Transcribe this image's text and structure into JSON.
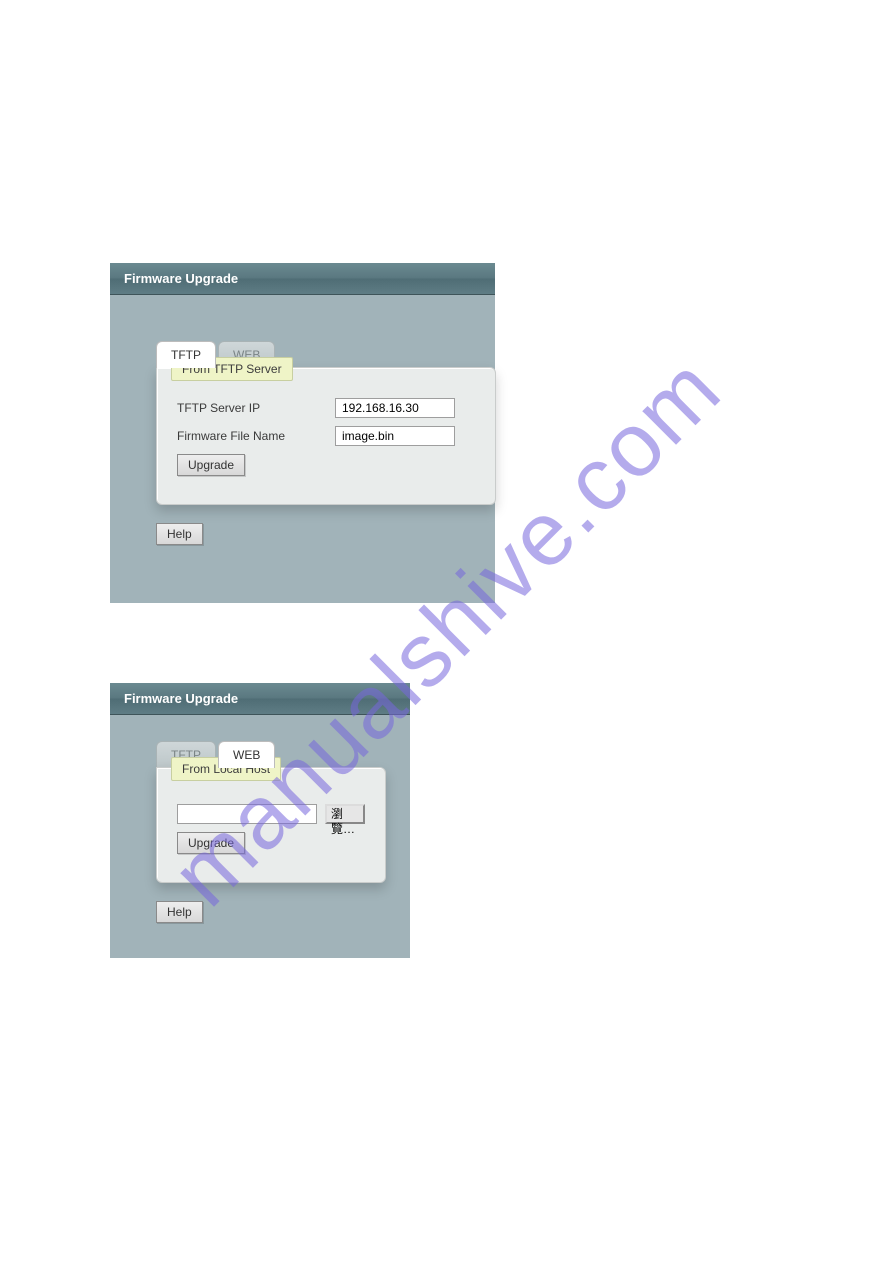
{
  "watermark_text": "manualshive.com",
  "panel1": {
    "title": "Firmware Upgrade",
    "tabs": {
      "tftp": "TFTP",
      "web": "WEB"
    },
    "legend": "From TFTP Server",
    "fields": {
      "server_ip_label": "TFTP Server IP",
      "server_ip_value": "192.168.16.30",
      "fw_file_label": "Firmware File Name",
      "fw_file_value": "image.bin"
    },
    "upgrade_label": "Upgrade",
    "help_label": "Help"
  },
  "panel2": {
    "title": "Firmware Upgrade",
    "tabs": {
      "tftp": "TFTP",
      "web": "WEB"
    },
    "legend": "From Local Host",
    "file_value": "",
    "browse_label": "瀏覽…",
    "upgrade_label": "Upgrade",
    "help_label": "Help"
  }
}
